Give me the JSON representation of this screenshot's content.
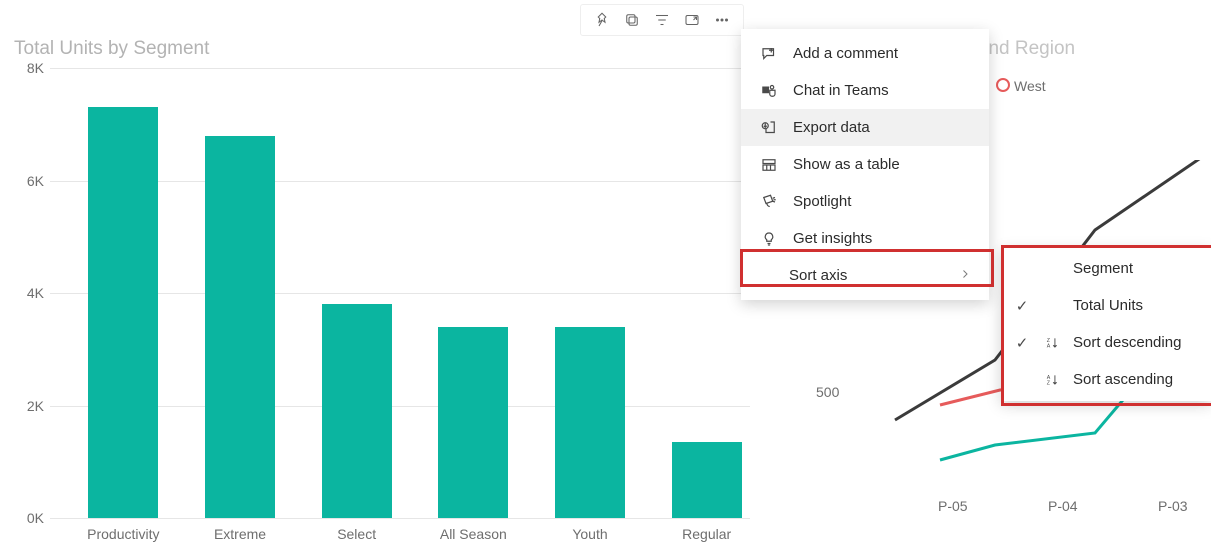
{
  "chart_data": [
    {
      "type": "bar",
      "title": "Total Units by Segment",
      "categories": [
        "Productivity",
        "Extreme",
        "Select",
        "All Season",
        "Youth",
        "Regular"
      ],
      "values": [
        7300,
        6800,
        3800,
        3400,
        3400,
        1350
      ],
      "ylim": [
        0,
        8000
      ],
      "yticks": [
        0,
        2000,
        4000,
        6000,
        8000
      ],
      "ytick_labels": [
        "0K",
        "2K",
        "4K",
        "6K",
        "8K"
      ],
      "bar_color": "#0bb5a0"
    },
    {
      "type": "line",
      "title_visible_suffix": "od and Region",
      "legend_visible": [
        "West"
      ],
      "x_visible": [
        "P-05",
        "P-04",
        "P-03"
      ],
      "ytick_visible": [
        500
      ],
      "series_partial": [
        {
          "name": "(dark)",
          "color": "#3b3b3b",
          "points": [
            [
              55,
              260
            ],
            [
              155,
              200
            ],
            [
              255,
              70
            ],
            [
              365,
              -5
            ]
          ]
        },
        {
          "name": "West",
          "color": "#e65b5b",
          "points": [
            [
              100,
              245
            ],
            [
              160,
              230
            ],
            [
              255,
              223
            ],
            [
              365,
              200
            ]
          ]
        },
        {
          "name": "(teal)",
          "color": "#0bb5a0",
          "points": [
            [
              100,
              300
            ],
            [
              155,
              285
            ],
            [
              255,
              273
            ],
            [
              365,
              143
            ]
          ]
        }
      ]
    }
  ],
  "left_chart": {
    "title": "Total Units by Segment"
  },
  "right_chart": {
    "title_suffix": "od and Region",
    "legend_west": "West",
    "ytick_500": "500",
    "x0": "P-05",
    "x1": "P-04",
    "x2": "P-03"
  },
  "visual_header": {
    "pin": "Pin",
    "copy": "Copy",
    "filter": "Filter",
    "focus": "Focus",
    "more": "More options"
  },
  "menu": {
    "add_comment": "Add a comment",
    "chat_teams": "Chat in Teams",
    "export_data": "Export data",
    "show_table": "Show as a table",
    "spotlight": "Spotlight",
    "get_insights": "Get insights",
    "sort_axis": "Sort axis"
  },
  "submenu": {
    "segment": "Segment",
    "total_units": "Total Units",
    "sort_desc": "Sort descending",
    "sort_asc": "Sort ascending"
  }
}
